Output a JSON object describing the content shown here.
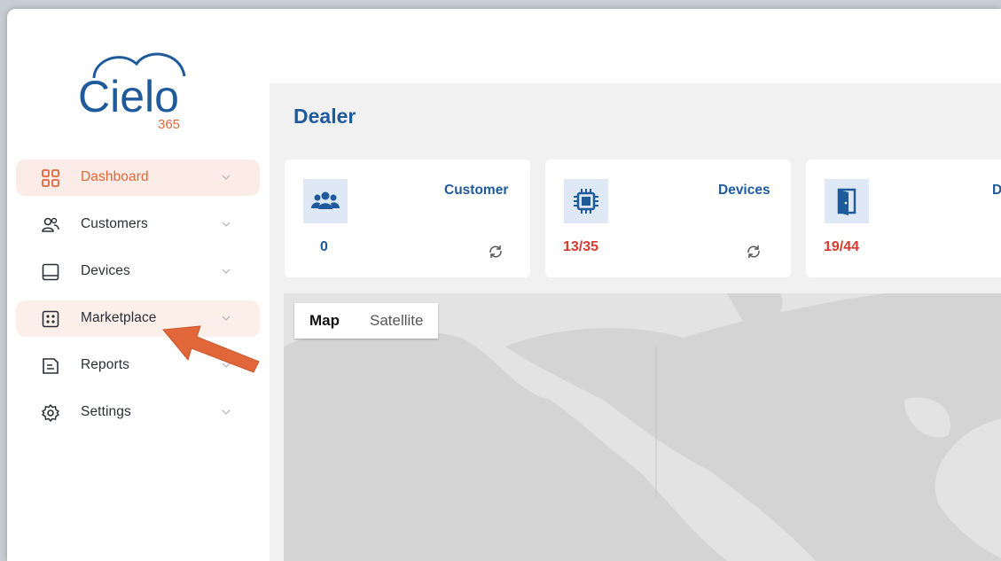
{
  "app": {
    "brand_name": "Cielo",
    "brand_sub": "365"
  },
  "sidebar": {
    "items": [
      {
        "label": "Dashboard",
        "icon": "dashboard-icon"
      },
      {
        "label": "Customers",
        "icon": "users-icon"
      },
      {
        "label": "Devices",
        "icon": "device-icon"
      },
      {
        "label": "Marketplace",
        "icon": "marketplace-icon"
      },
      {
        "label": "Reports",
        "icon": "report-icon"
      },
      {
        "label": "Settings",
        "icon": "gear-icon"
      }
    ]
  },
  "main": {
    "title": "Dealer",
    "cards": [
      {
        "title": "Customer",
        "value": "0",
        "value_color": "#1f5a9c",
        "icon": "customers-icon"
      },
      {
        "title": "Devices",
        "value": "13/35",
        "value_color": "#d63a2f",
        "icon": "chip-icon"
      },
      {
        "title": "D",
        "value": "19/44",
        "value_color": "#d63a2f",
        "icon": "door-icon"
      }
    ],
    "map": {
      "type_options": [
        "Map",
        "Satellite"
      ],
      "selected": "Map"
    }
  },
  "colors": {
    "accent": "#e1673a",
    "primary": "#1f5a9c",
    "alert": "#d63a2f"
  }
}
